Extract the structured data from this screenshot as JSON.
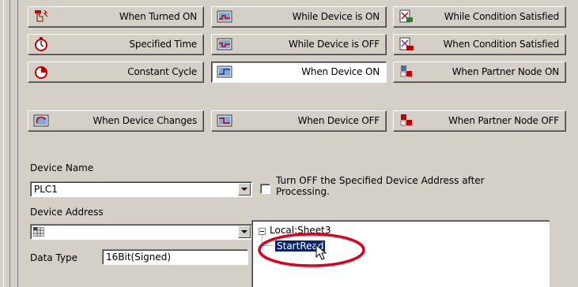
{
  "trigger_buttons": [
    {
      "label": "When Turned ON",
      "icon": "hand-bolt-icon"
    },
    {
      "label": "While Device is ON",
      "icon": "device-chart-icon"
    },
    {
      "label": "While Condition Satisfied",
      "icon": "condition-icon"
    },
    {
      "label": "Specified Time",
      "icon": "stopwatch-icon"
    },
    {
      "label": "While Device is OFF",
      "icon": "device-chart-icon"
    },
    {
      "label": "When Condition Satisfied",
      "icon": "condition-ok-icon"
    },
    {
      "label": "Constant Cycle",
      "icon": "cycle-icon"
    },
    {
      "label": "When Device ON",
      "icon": "device-on-icon"
    },
    {
      "label": "When Partner Node ON",
      "icon": "partner-node-icon"
    },
    {
      "label": "When Device Changes",
      "icon": "device-change-icon"
    },
    {
      "label": "When Device OFF",
      "icon": "device-off-icon"
    },
    {
      "label": "When Partner Node OFF",
      "icon": "partner-node-off-icon"
    }
  ],
  "selected_trigger": "When Device ON",
  "form": {
    "device_name_label": "Device Name",
    "device_name_value": "PLC1",
    "turn_off_label_line1": "Turn OFF the Specified Device Address after",
    "turn_off_label_line2": "Processing.",
    "turn_off_checked": false,
    "device_address_label": "Device Address",
    "device_address_value": "",
    "data_type_label": "Data Type",
    "data_type_value": "16Bit(Signed)"
  },
  "tree": {
    "root": "Local:Sheet3",
    "child": "StartRead"
  },
  "colors": {
    "panel": "#d4d0c8",
    "selection": "#0a246a",
    "highlight_circle": "#e0001b"
  }
}
